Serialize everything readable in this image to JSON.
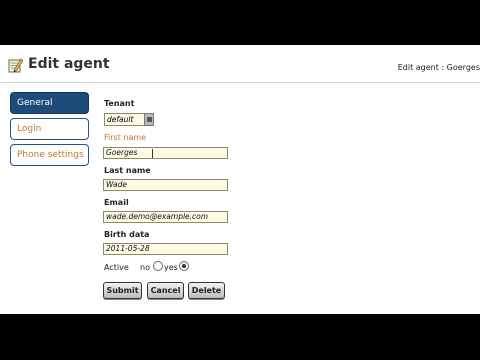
{
  "header": {
    "title": "Edit agent",
    "breadcrumb": "Edit agent : Goerges",
    "icon": "edit-form-icon"
  },
  "sidebar": {
    "items": [
      {
        "label": "General",
        "active": true
      },
      {
        "label": "Login",
        "active": false
      },
      {
        "label": "Phone settings",
        "active": false
      }
    ]
  },
  "form": {
    "tenant": {
      "label": "Tenant",
      "value": "default"
    },
    "first_name": {
      "label": "First name",
      "value": "Goerges"
    },
    "last_name": {
      "label": "Last name",
      "value": "Wade"
    },
    "email": {
      "label": "Email",
      "value": "wade.demo@example.com"
    },
    "birth_date": {
      "label": "Birth data",
      "value": "2011-05-28"
    },
    "active": {
      "label": "Active",
      "options": [
        "no",
        "yes"
      ],
      "selected": "yes"
    }
  },
  "buttons": {
    "submit": "Submit",
    "cancel": "Cancel",
    "delete": "Delete"
  },
  "colors": {
    "active_nav": "#1e4c7a",
    "accent_text": "#c5742a",
    "field_bg": "#fbfbe6"
  }
}
